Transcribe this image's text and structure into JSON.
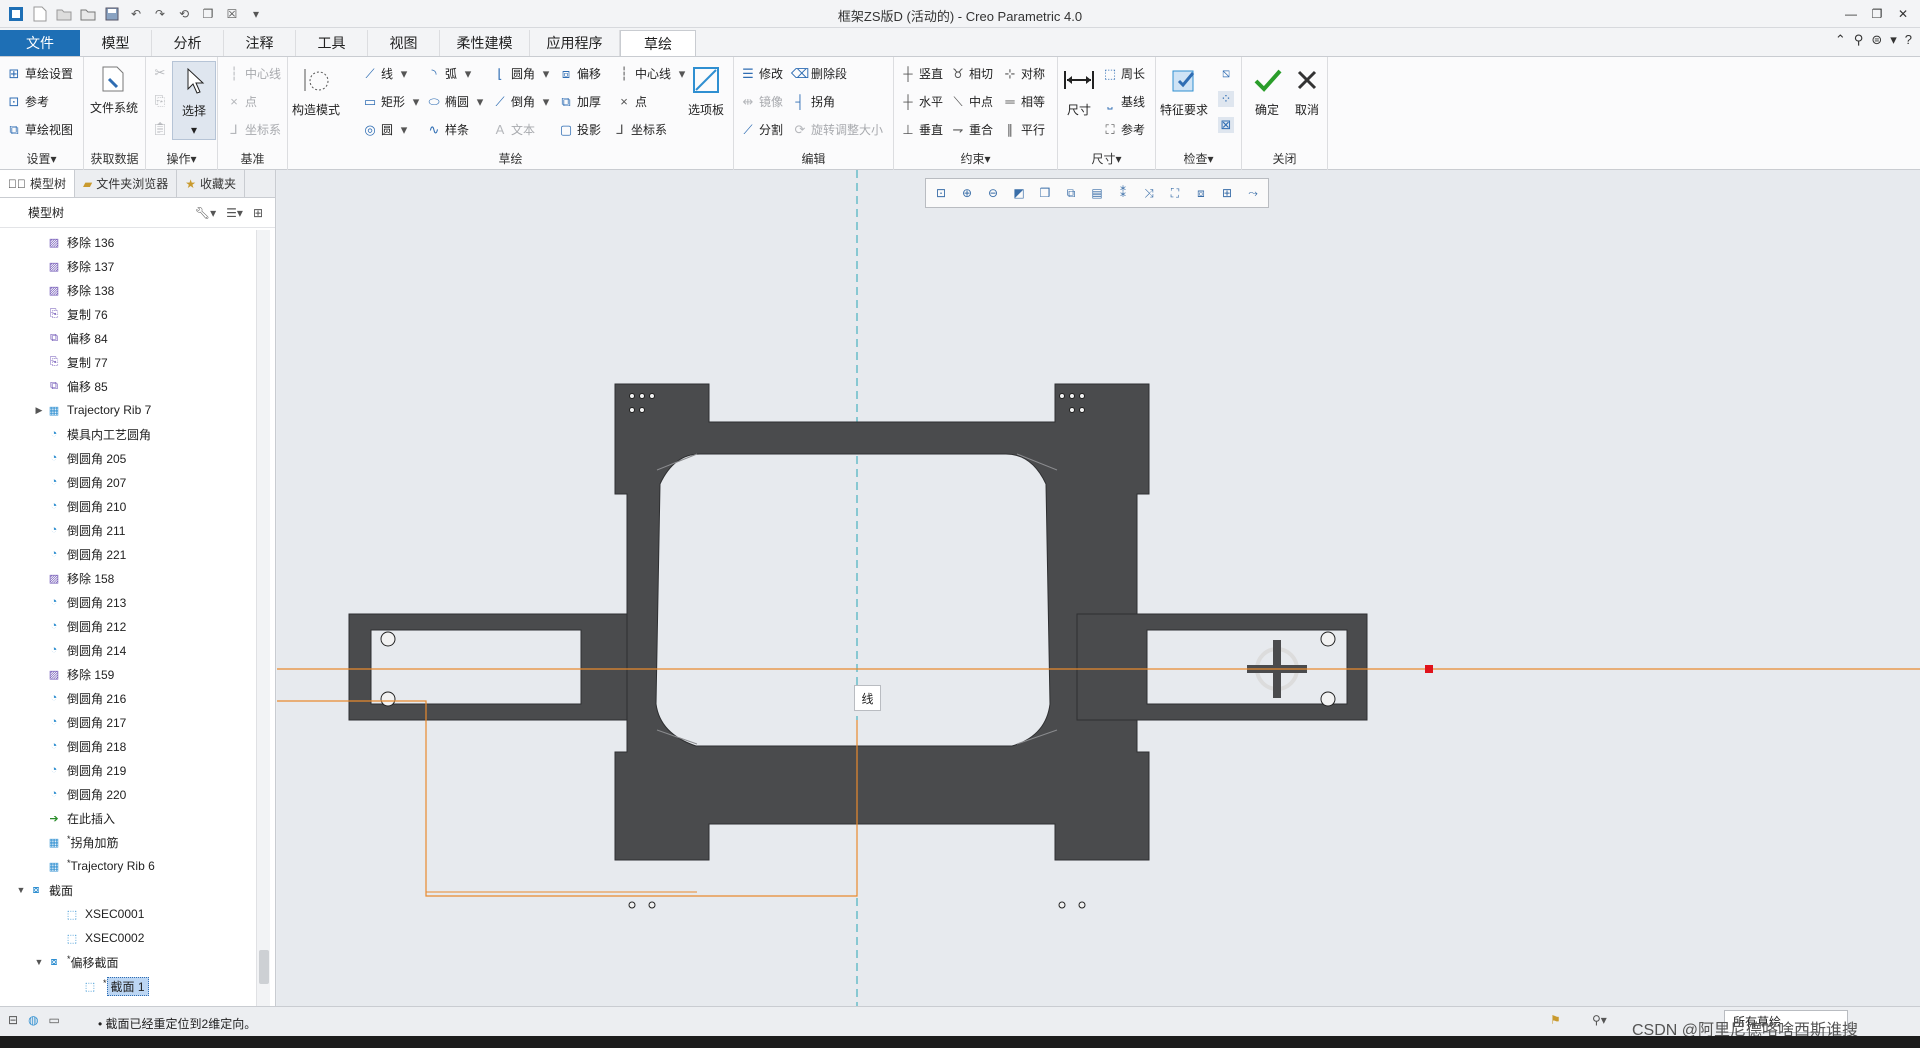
{
  "window": {
    "title": "框架ZS版D (活动的) - Creo Parametric 4.0"
  },
  "tabs": [
    {
      "label": "文件"
    },
    {
      "label": "模型"
    },
    {
      "label": "分析"
    },
    {
      "label": "注释"
    },
    {
      "label": "工具"
    },
    {
      "label": "视图"
    },
    {
      "label": "柔性建模"
    },
    {
      "label": "应用程序"
    },
    {
      "label": "草绘"
    }
  ],
  "ribbon": {
    "setup": {
      "label": "设置▾",
      "sketch_setup": "草绘设置",
      "reference": "参考",
      "sketch_view": "草绘视图"
    },
    "get_data": {
      "label": "获取数据",
      "file_system": "文件系统"
    },
    "operations": {
      "label": "操作▾",
      "select": "选择"
    },
    "datum": {
      "label": "基准",
      "centerline": "中心线",
      "point": "点",
      "csys": "坐标系"
    },
    "sketching": {
      "label": "草绘",
      "construction_mode": "构造模式",
      "line": "线",
      "arc": "弧",
      "fillet": "圆角",
      "offset": "偏移",
      "centerline": "中心线",
      "rectangle": "矩形",
      "ellipse": "椭圆",
      "chamfer": "倒角",
      "thicken": "加厚",
      "point": "点",
      "circle": "圆",
      "spline": "样条",
      "text": "文本",
      "project": "投影",
      "csys": "坐标系",
      "palette": "选项板"
    },
    "editing": {
      "label": "编辑",
      "modify": "修改",
      "delete_segment": "删除段",
      "mirror": "镜像",
      "corner": "拐角",
      "divide": "分割",
      "rotate_resize": "旋转调整大小"
    },
    "constrain": {
      "label": "约束▾",
      "vertical": "竖直",
      "tangent": "相切",
      "symmetric": "对称",
      "horizontal": "水平",
      "midpoint": "中点",
      "equal": "相等",
      "perpendicular": "垂直",
      "coincident": "重合",
      "parallel": "平行"
    },
    "dimension": {
      "label": "尺寸▾",
      "dimension": "尺寸",
      "perimeter": "周长",
      "baseline": "基线",
      "reference": "参考"
    },
    "inspect": {
      "label": "检查▾",
      "feature_requirements": "特征要求"
    },
    "close": {
      "label": "关闭",
      "ok": "确定",
      "cancel": "取消"
    }
  },
  "panel": {
    "tabs": [
      {
        "label": "模型树"
      },
      {
        "label": "文件夹浏览器"
      },
      {
        "label": "收藏夹"
      }
    ],
    "header": "模型树",
    "items": [
      {
        "label": "移除 136",
        "icon": "remove-icon",
        "indent": 1
      },
      {
        "label": "移除 137",
        "icon": "remove-icon",
        "indent": 1
      },
      {
        "label": "移除 138",
        "icon": "remove-icon",
        "indent": 1
      },
      {
        "label": "复制 76",
        "icon": "copy-icon",
        "indent": 1
      },
      {
        "label": "偏移 84",
        "icon": "offset-icon",
        "indent": 1
      },
      {
        "label": "复制 77",
        "icon": "copy-icon",
        "indent": 1
      },
      {
        "label": "偏移 85",
        "icon": "offset-icon",
        "indent": 1
      },
      {
        "label": "Trajectory Rib 7",
        "icon": "rib-icon",
        "indent": 1,
        "expander": "▶"
      },
      {
        "label": "模具内工艺圆角",
        "icon": "round-icon",
        "indent": 1
      },
      {
        "label": "倒圆角 205",
        "icon": "round-icon",
        "indent": 1
      },
      {
        "label": "倒圆角 207",
        "icon": "round-icon",
        "indent": 1
      },
      {
        "label": "倒圆角 210",
        "icon": "round-icon",
        "indent": 1
      },
      {
        "label": "倒圆角 211",
        "icon": "round-icon",
        "indent": 1
      },
      {
        "label": "倒圆角 221",
        "icon": "round-icon",
        "indent": 1
      },
      {
        "label": "移除 158",
        "icon": "remove-icon",
        "indent": 1
      },
      {
        "label": "倒圆角 213",
        "icon": "round-icon",
        "indent": 1
      },
      {
        "label": "倒圆角 212",
        "icon": "round-icon",
        "indent": 1
      },
      {
        "label": "倒圆角 214",
        "icon": "round-icon",
        "indent": 1
      },
      {
        "label": "移除 159",
        "icon": "remove-icon",
        "indent": 1
      },
      {
        "label": "倒圆角 216",
        "icon": "round-icon",
        "indent": 1
      },
      {
        "label": "倒圆角 217",
        "icon": "round-icon",
        "indent": 1
      },
      {
        "label": "倒圆角 218",
        "icon": "round-icon",
        "indent": 1
      },
      {
        "label": "倒圆角 219",
        "icon": "round-icon",
        "indent": 1
      },
      {
        "label": "倒圆角 220",
        "icon": "round-icon",
        "indent": 1
      },
      {
        "label": "在此插入",
        "icon": "insert-arrow-icon",
        "indent": 1
      },
      {
        "label": "拐角加筋",
        "icon": "rib-icon",
        "indent": 1,
        "prefix": "*"
      },
      {
        "label": "Trajectory Rib 6",
        "icon": "rib-icon",
        "indent": 1,
        "prefix": "*"
      },
      {
        "label": "截面",
        "icon": "section-icon",
        "indent": 0,
        "expander": "▼"
      },
      {
        "label": "XSEC0001",
        "icon": "xsec-icon",
        "indent": 2
      },
      {
        "label": "XSEC0002",
        "icon": "xsec-icon",
        "indent": 2
      },
      {
        "label": "偏移截面",
        "icon": "section-icon",
        "indent": 1,
        "expander": "▼",
        "prefix": "*"
      },
      {
        "label": "截面 1",
        "icon": "xsec-icon",
        "indent": 3,
        "prefix": "*",
        "selected": true
      }
    ]
  },
  "canvas": {
    "tooltip": "线"
  },
  "status": {
    "message": "• 截面已经重定位到2维定向。",
    "filter": "所有草绘",
    "watermark": "CSDN @阿里尼德咯啥西斯谁搜"
  },
  "colors": {
    "file_tab": "#1e6fb5",
    "canvas_bg": "#e7eaee",
    "part": "#4a4b4d",
    "sketch_line": "#e88a2e",
    "axis": "#2aa7b5",
    "handle": "#e0121b"
  }
}
